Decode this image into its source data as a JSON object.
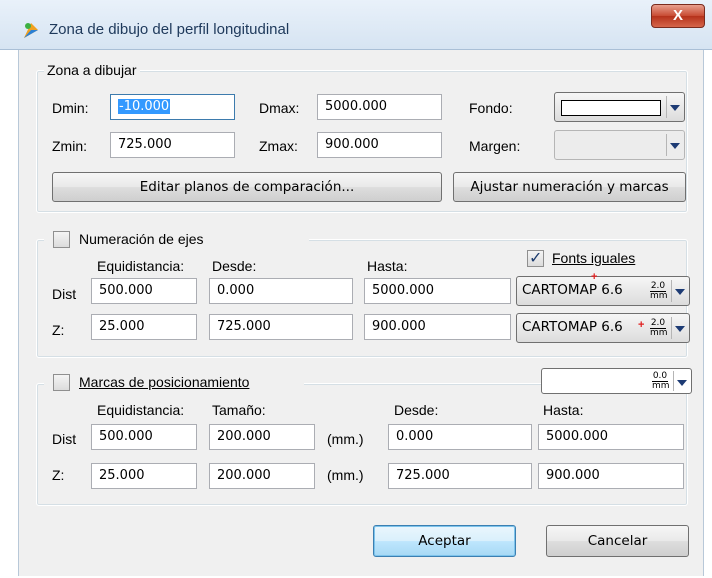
{
  "window": {
    "title": "Zona de dibujo del perfil longitudinal",
    "close_label": "X"
  },
  "zona": {
    "legend": "Zona a dibujar",
    "dmin_label": "Dmin:",
    "dmin_value": "-10.000",
    "dmax_label": "Dmax:",
    "dmax_value": "5000.000",
    "zmin_label": "Zmin:",
    "zmin_value": "725.000",
    "zmax_label": "Zmax:",
    "zmax_value": "900.000",
    "fondo_label": "Fondo:",
    "margen_label": "Margen:",
    "editar_button": "Editar planos de comparación...",
    "ajustar_button": "Ajustar numeración y marcas"
  },
  "numeracion": {
    "checkbox_label": "Numeración de ejes",
    "checked": false,
    "fonts_iguales_label": "Fonts iguales",
    "fonts_iguales_checked": true,
    "col_equidistancia": "Equidistancia:",
    "col_desde": "Desde:",
    "col_hasta": "Hasta:",
    "rows": [
      {
        "label": "Dist",
        "equidistancia": "500.000",
        "desde": "0.000",
        "hasta": "5000.000",
        "font": "CARTOMAP 6.6",
        "size_top": "2.0",
        "size_unit": "mm"
      },
      {
        "label": "Z:",
        "equidistancia": "25.000",
        "desde": "725.000",
        "hasta": "900.000",
        "font": "CARTOMAP 6.6",
        "size_top": "2.0",
        "size_unit": "mm"
      }
    ]
  },
  "marcas": {
    "checkbox_label": "Marcas de posicionamiento",
    "checked": false,
    "size_top": "0.0",
    "size_unit": "mm",
    "col_equidistancia": "Equidistancia:",
    "col_tamano": "Tamaño:",
    "col_desde": "Desde:",
    "col_hasta": "Hasta:",
    "unit": "(mm.)",
    "rows": [
      {
        "label": "Dist",
        "equidistancia": "500.000",
        "tamano": "200.000",
        "desde": "0.000",
        "hasta": "5000.000"
      },
      {
        "label": "Z:",
        "equidistancia": "25.000",
        "tamano": "200.000",
        "desde": "725.000",
        "hasta": "900.000"
      }
    ]
  },
  "footer": {
    "aceptar": "Aceptar",
    "cancelar": "Cancelar"
  }
}
